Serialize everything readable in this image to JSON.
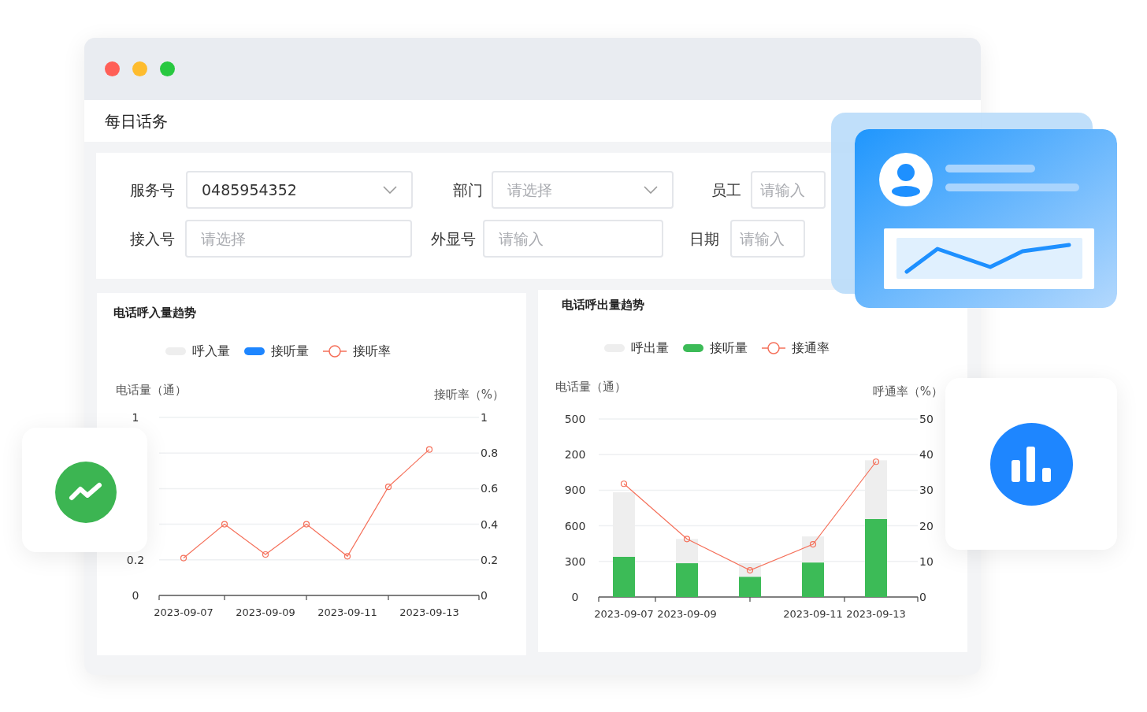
{
  "window": {
    "title": "每日话务"
  },
  "filters": [
    {
      "label": "服务号",
      "kind": "select",
      "value": "0485954352"
    },
    {
      "label": "部门",
      "kind": "select",
      "placeholder": "请选择"
    },
    {
      "label": "员工",
      "kind": "input",
      "placeholder": "请输入"
    },
    {
      "label": "接入号",
      "kind": "input",
      "placeholder": "请选择"
    },
    {
      "label": "外显号",
      "kind": "input",
      "placeholder": "请输入"
    },
    {
      "label": "日期",
      "kind": "input",
      "placeholder": "请输入"
    }
  ],
  "charts": [
    {
      "title": "电话呼入量趋势",
      "left_axis_title": "电话量（通）",
      "left_axis_labels": [
        "1",
        "0.2",
        "0"
      ],
      "chart_data": {
        "type": "bar",
        "ylabel": "接听率（%）",
        "categories": [
          "2023-09-07",
          null,
          "2023-09-09",
          null,
          "2023-09-11",
          null,
          "2023-09-13"
        ],
        "ylim": [
          0,
          1
        ],
        "yticks": [
          0,
          0.2,
          0.4,
          0.6,
          0.8,
          1
        ],
        "grid": true,
        "legend": "top",
        "series": [
          {
            "name": "呼入量",
            "type": "bar",
            "color": "#eeeeee",
            "values": [
              null,
              null,
              null,
              null,
              null,
              null,
              null
            ]
          },
          {
            "name": "接听量",
            "type": "bar",
            "color": "#1e86ff",
            "values": [
              null,
              null,
              null,
              null,
              null,
              null,
              null
            ]
          },
          {
            "name": "接听率",
            "type": "line",
            "marker": "circle",
            "color": "#f5705a",
            "values": [
              0.21,
              0.4,
              0.23,
              0.4,
              0.22,
              0.61,
              0.82
            ]
          }
        ]
      }
    },
    {
      "title": "电话呼出量趋势",
      "left_axis_title": "电话量（通）",
      "left_axis_labels": [
        "500",
        "200",
        "900",
        "600",
        "300",
        "0"
      ],
      "chart_data": {
        "type": "bar",
        "ylabel": "呼通率（%）",
        "categories": [
          "2023-09-07",
          "2023-09-09",
          null,
          "2023-09-11",
          "2023-09-13"
        ],
        "ylim": [
          0,
          50
        ],
        "yticks": [
          0,
          10,
          20,
          30,
          40,
          50
        ],
        "stacked": true,
        "grid": true,
        "legend": "top",
        "series": [
          {
            "name": "接听量",
            "type": "bar",
            "color": "#3cbb57",
            "values": [
              11.3,
              9.5,
              5.7,
              9.7,
              21.9
            ]
          },
          {
            "name": "呼出量",
            "type": "bar",
            "color": "#eeeeee",
            "values": [
              18.1,
              6.8,
              3.8,
              7.3,
              16.5
            ]
          },
          {
            "name": "接通率",
            "type": "line",
            "marker": "circle",
            "color": "#f5705a",
            "values": [
              31.8,
              16.3,
              7.5,
              14.8,
              38
            ]
          }
        ]
      }
    }
  ]
}
